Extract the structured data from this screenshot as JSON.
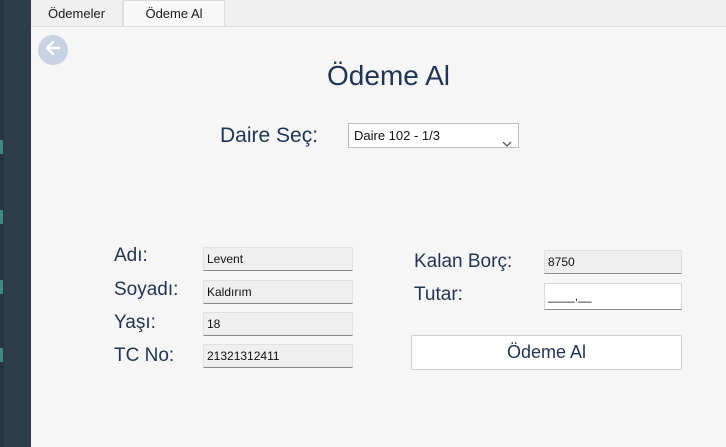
{
  "tabs": [
    {
      "label": "Ödemeler",
      "active": false
    },
    {
      "label": "Ödeme Al",
      "active": true
    }
  ],
  "page": {
    "title": "Ödeme Al"
  },
  "daire": {
    "label": "Daire Seç:",
    "selected": "Daire 102 - 1/3"
  },
  "resident": {
    "name_label": "Adı:",
    "name_value": "Levent",
    "surname_label": "Soyadı:",
    "surname_value": "Kaldırım",
    "age_label": "Yaşı:",
    "age_value": "18",
    "tc_label": "TC No:",
    "tc_value": "21321312411"
  },
  "payment": {
    "remaining_label": "Kalan Borç:",
    "remaining_value": "8750",
    "amount_label": "Tutar:",
    "amount_value": "____,__",
    "submit_label": "Ödeme Al"
  },
  "colors": {
    "accent": "#1f3454",
    "sidebar": "#2d3e4a",
    "back_button": "#c7d2e3"
  },
  "icons": {
    "back": "back-arrow-icon",
    "dropdown": "chevron-down-icon"
  }
}
